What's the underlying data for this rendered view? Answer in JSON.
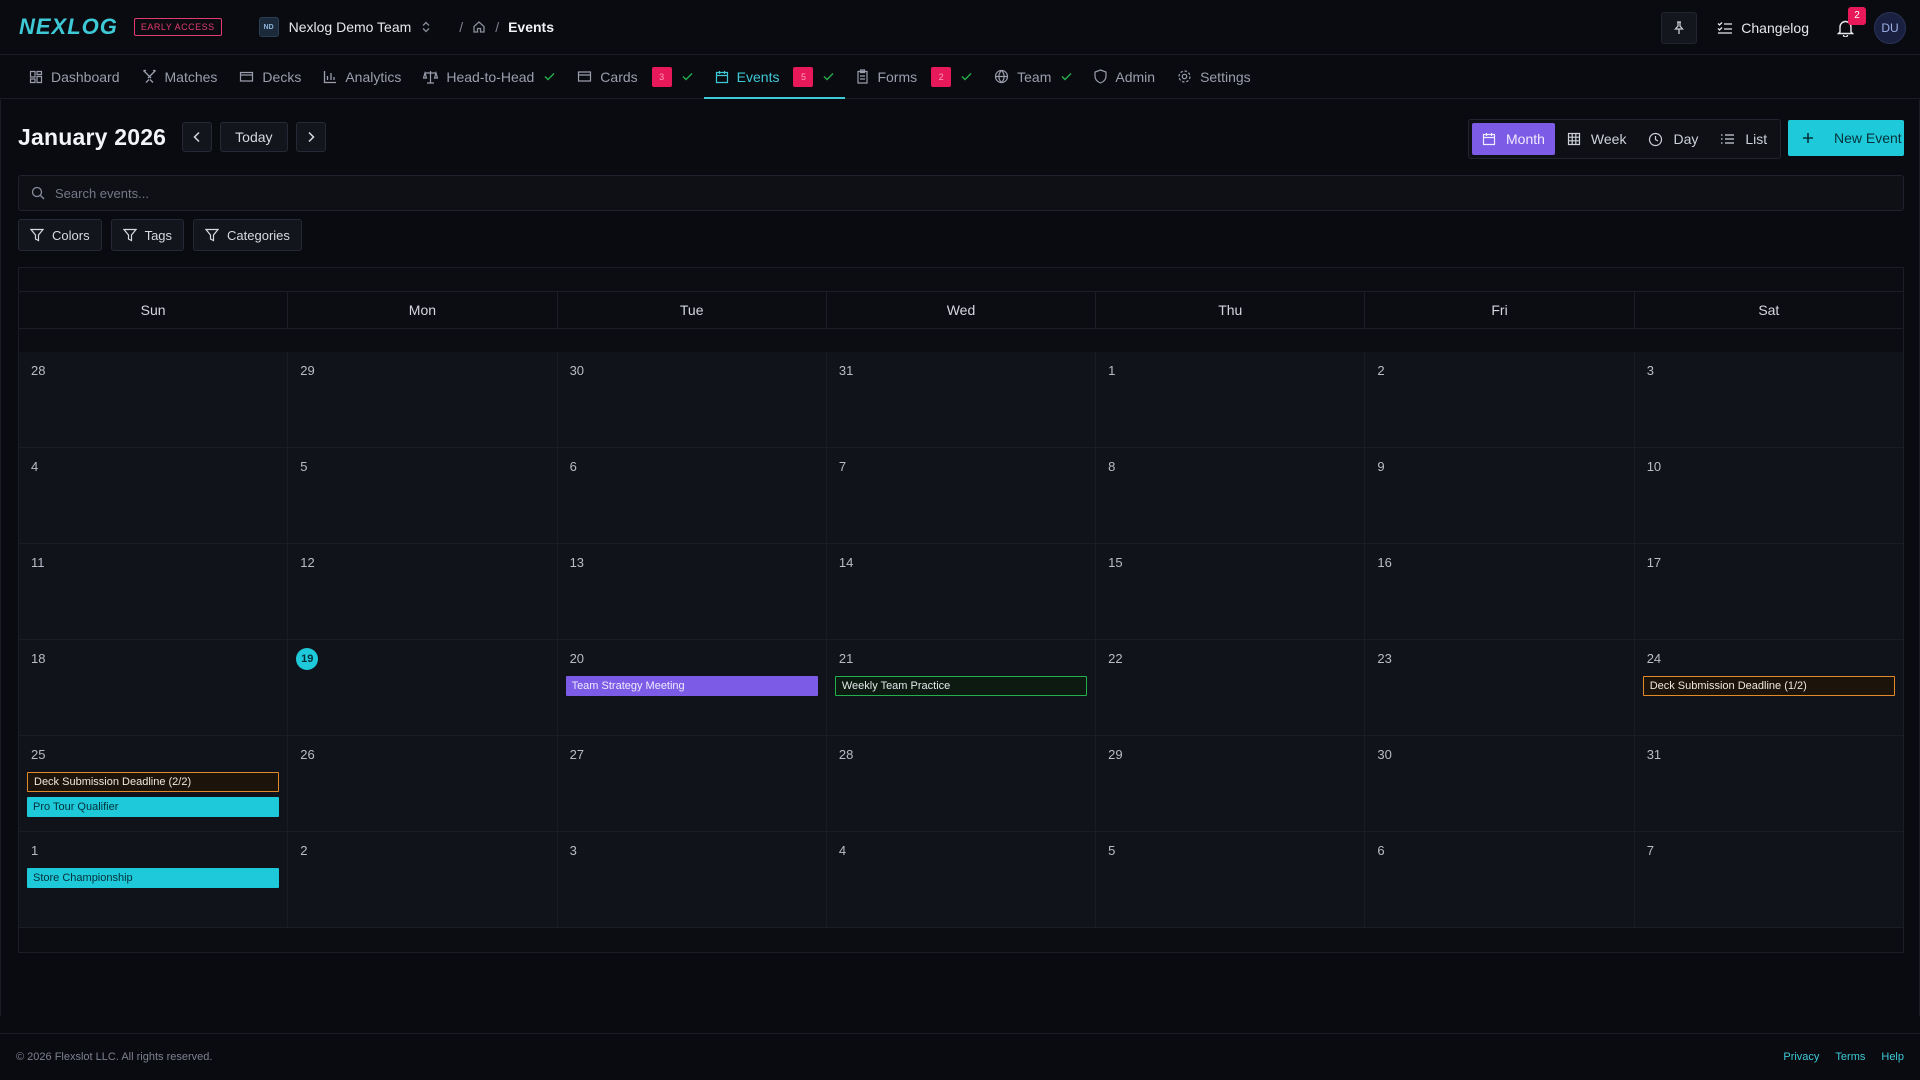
{
  "brand": {
    "logo": "NEXLOG",
    "badge": "EARLY ACCESS"
  },
  "team": {
    "initials": "ND",
    "name": "Nexlog Demo Team"
  },
  "breadcrumb": {
    "current": "Events"
  },
  "topbar": {
    "changelog": "Changelog",
    "notifications": "2",
    "user_initials": "DU"
  },
  "nav": {
    "dashboard": "Dashboard",
    "matches": "Matches",
    "decks": "Decks",
    "analytics": "Analytics",
    "head_to_head": "Head-to-Head",
    "cards": "Cards",
    "cards_badge": "3",
    "events": "Events",
    "events_badge": "5",
    "forms": "Forms",
    "forms_badge": "2",
    "team": "Team",
    "admin": "Admin",
    "settings": "Settings"
  },
  "calendar_header": {
    "title": "January 2026",
    "today": "Today"
  },
  "views": {
    "month": "Month",
    "week": "Week",
    "day": "Day",
    "list": "List"
  },
  "new_event": "New Event",
  "search": {
    "placeholder": "Search events..."
  },
  "filters": {
    "colors": "Colors",
    "tags": "Tags",
    "categories": "Categories"
  },
  "days_of_week": [
    "Sun",
    "Mon",
    "Tue",
    "Wed",
    "Thu",
    "Fri",
    "Sat"
  ],
  "weeks": [
    {
      "days": [
        {
          "n": "28"
        },
        {
          "n": "29"
        },
        {
          "n": "30"
        },
        {
          "n": "31"
        },
        {
          "n": "1"
        },
        {
          "n": "2"
        },
        {
          "n": "3"
        }
      ]
    },
    {
      "days": [
        {
          "n": "4"
        },
        {
          "n": "5"
        },
        {
          "n": "6"
        },
        {
          "n": "7"
        },
        {
          "n": "8"
        },
        {
          "n": "9"
        },
        {
          "n": "10"
        }
      ]
    },
    {
      "days": [
        {
          "n": "11"
        },
        {
          "n": "12"
        },
        {
          "n": "13"
        },
        {
          "n": "14"
        },
        {
          "n": "15"
        },
        {
          "n": "16"
        },
        {
          "n": "17"
        }
      ]
    },
    {
      "days": [
        {
          "n": "18"
        },
        {
          "n": "19",
          "today": true
        },
        {
          "n": "20",
          "events": [
            {
              "title": "Team Strategy Meeting",
              "style": "purple"
            }
          ]
        },
        {
          "n": "21",
          "events": [
            {
              "title": "Weekly Team Practice",
              "style": "green"
            }
          ]
        },
        {
          "n": "22"
        },
        {
          "n": "23"
        },
        {
          "n": "24",
          "events": [
            {
              "title": "Deck Submission Deadline (1/2)",
              "style": "orange"
            }
          ]
        }
      ]
    },
    {
      "days": [
        {
          "n": "25",
          "events": [
            {
              "title": "Deck Submission Deadline (2/2)",
              "style": "orange"
            },
            {
              "title": "Pro Tour Qualifier",
              "style": "cyan"
            }
          ]
        },
        {
          "n": "26"
        },
        {
          "n": "27"
        },
        {
          "n": "28"
        },
        {
          "n": "29"
        },
        {
          "n": "30"
        },
        {
          "n": "31"
        }
      ]
    },
    {
      "days": [
        {
          "n": "1",
          "events": [
            {
              "title": "Store Championship",
              "style": "cyan"
            }
          ]
        },
        {
          "n": "2"
        },
        {
          "n": "3"
        },
        {
          "n": "4"
        },
        {
          "n": "5"
        },
        {
          "n": "6"
        },
        {
          "n": "7"
        }
      ]
    }
  ],
  "footer": {
    "copyright": "© 2026 Flexslot LLC. All rights reserved.",
    "privacy": "Privacy",
    "terms": "Terms",
    "help": "Help"
  },
  "colors": {
    "accent": "#1ec9d9",
    "purple": "#7c5ce6",
    "alert": "#e8195a",
    "green": "#22b14c",
    "orange": "#e08a2a"
  }
}
